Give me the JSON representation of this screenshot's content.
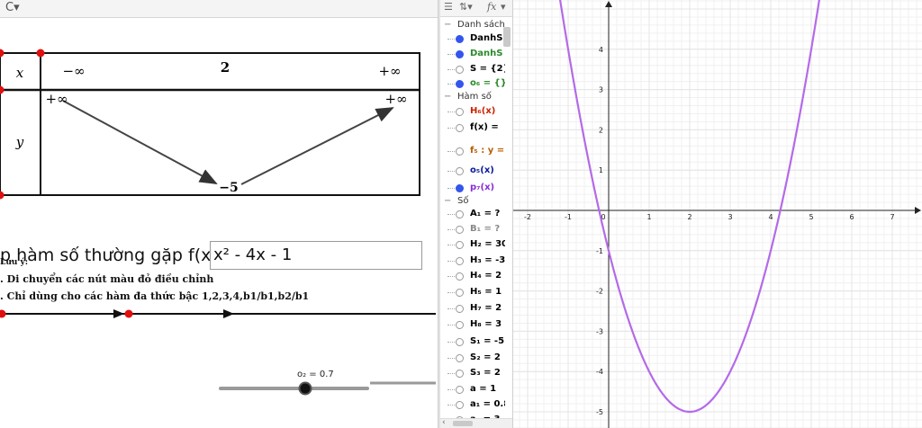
{
  "toolbar": {
    "icon": "C▾"
  },
  "variation_table": {
    "x_label": "x",
    "y_label": "y",
    "x_values": [
      "−∞",
      "2",
      "+∞"
    ],
    "y_left": "+∞",
    "y_right": "+∞",
    "y_min": "−5"
  },
  "function_label": "p hàm số thường gặp f(x)=",
  "function_value": "x² - 4x - 1",
  "notes": {
    "heading": "Lưu ý:",
    "line1": ". Di chuyển các nút màu đỏ điều chỉnh",
    "line2": ". Chỉ dùng cho các hàm đa thức bậc 1,2,3,4,b1/b1,b2/b1"
  },
  "slider": {
    "label": "o₂ = 0.7",
    "value": 0.7
  },
  "algebra": {
    "toolbar_fx": "fx",
    "categories": {
      "danh_sach": "Danh sách",
      "ham_so": "Hàm số",
      "so": "Số"
    },
    "rows": [
      {
        "text": "DanhS",
        "color": "#000000",
        "dot": "#3355ee"
      },
      {
        "text": "DanhS",
        "color": "#2a8a2a",
        "dot": "#3355ee"
      },
      {
        "text": "S = {2}",
        "color": "#000000",
        "dot": ""
      },
      {
        "text": "o₆ = {}",
        "color": "#2a8a2a",
        "dot": "#3355ee"
      },
      {
        "text": "H₆(x)",
        "color": "#cc2200",
        "dot": ""
      },
      {
        "text": "f(x) =",
        "color": "#000000",
        "dot": ""
      },
      {
        "text": "f₅ : y =",
        "color": "#b85c00",
        "dot": ""
      },
      {
        "text": "o₅(x)",
        "color": "#0a1a9a",
        "dot": ""
      },
      {
        "text": "p₇(x)",
        "color": "#8a2bd8",
        "dot": "#3355ee"
      },
      {
        "text": "A₁ = ?",
        "color": "#000000",
        "dot": ""
      },
      {
        "text": "B₁ = ?",
        "color": "#888888",
        "dot": ""
      },
      {
        "text": "H₂ = 30",
        "color": "#000000",
        "dot": ""
      },
      {
        "text": "H₃ = -3",
        "color": "#000000",
        "dot": ""
      },
      {
        "text": "H₄ = 2",
        "color": "#000000",
        "dot": ""
      },
      {
        "text": "H₅ = 1",
        "color": "#000000",
        "dot": ""
      },
      {
        "text": "H₇ = 2",
        "color": "#000000",
        "dot": ""
      },
      {
        "text": "H₈ = 3",
        "color": "#000000",
        "dot": ""
      },
      {
        "text": "S₁ = -5",
        "color": "#000000",
        "dot": ""
      },
      {
        "text": "S₂ = 2",
        "color": "#000000",
        "dot": ""
      },
      {
        "text": "S₃ = 2",
        "color": "#000000",
        "dot": ""
      },
      {
        "text": "a = 1",
        "color": "#000000",
        "dot": ""
      },
      {
        "text": "a₁ = 0.8",
        "color": "#000000",
        "dot": ""
      },
      {
        "text": "a₂ = 3",
        "color": "#000000",
        "dot": ""
      }
    ]
  },
  "graph": {
    "x_ticks": [
      "-2",
      "-1",
      "0",
      "1",
      "2",
      "3",
      "4",
      "5",
      "6",
      "7"
    ],
    "y_ticks": [
      "4",
      "3",
      "2",
      "1",
      "-1",
      "-2",
      "-3",
      "-4",
      "-5"
    ],
    "curve_color": "#b46ae8",
    "axis_color": "#222222",
    "grid_color": "#e4e4e4",
    "x_range": [
      -2.8,
      7.5
    ],
    "y_range": [
      -5.4,
      5.2
    ]
  }
}
